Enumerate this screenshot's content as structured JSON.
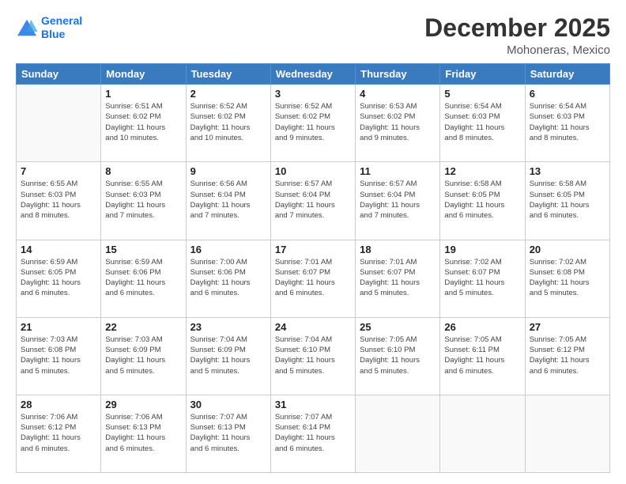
{
  "header": {
    "logo_line1": "General",
    "logo_line2": "Blue",
    "title": "December 2025",
    "subtitle": "Mohoneras, Mexico"
  },
  "weekdays": [
    "Sunday",
    "Monday",
    "Tuesday",
    "Wednesday",
    "Thursday",
    "Friday",
    "Saturday"
  ],
  "weeks": [
    [
      {
        "day": "",
        "info": ""
      },
      {
        "day": "1",
        "info": "Sunrise: 6:51 AM\nSunset: 6:02 PM\nDaylight: 11 hours\nand 10 minutes."
      },
      {
        "day": "2",
        "info": "Sunrise: 6:52 AM\nSunset: 6:02 PM\nDaylight: 11 hours\nand 10 minutes."
      },
      {
        "day": "3",
        "info": "Sunrise: 6:52 AM\nSunset: 6:02 PM\nDaylight: 11 hours\nand 9 minutes."
      },
      {
        "day": "4",
        "info": "Sunrise: 6:53 AM\nSunset: 6:02 PM\nDaylight: 11 hours\nand 9 minutes."
      },
      {
        "day": "5",
        "info": "Sunrise: 6:54 AM\nSunset: 6:03 PM\nDaylight: 11 hours\nand 8 minutes."
      },
      {
        "day": "6",
        "info": "Sunrise: 6:54 AM\nSunset: 6:03 PM\nDaylight: 11 hours\nand 8 minutes."
      }
    ],
    [
      {
        "day": "7",
        "info": "Sunrise: 6:55 AM\nSunset: 6:03 PM\nDaylight: 11 hours\nand 8 minutes."
      },
      {
        "day": "8",
        "info": "Sunrise: 6:55 AM\nSunset: 6:03 PM\nDaylight: 11 hours\nand 7 minutes."
      },
      {
        "day": "9",
        "info": "Sunrise: 6:56 AM\nSunset: 6:04 PM\nDaylight: 11 hours\nand 7 minutes."
      },
      {
        "day": "10",
        "info": "Sunrise: 6:57 AM\nSunset: 6:04 PM\nDaylight: 11 hours\nand 7 minutes."
      },
      {
        "day": "11",
        "info": "Sunrise: 6:57 AM\nSunset: 6:04 PM\nDaylight: 11 hours\nand 7 minutes."
      },
      {
        "day": "12",
        "info": "Sunrise: 6:58 AM\nSunset: 6:05 PM\nDaylight: 11 hours\nand 6 minutes."
      },
      {
        "day": "13",
        "info": "Sunrise: 6:58 AM\nSunset: 6:05 PM\nDaylight: 11 hours\nand 6 minutes."
      }
    ],
    [
      {
        "day": "14",
        "info": "Sunrise: 6:59 AM\nSunset: 6:05 PM\nDaylight: 11 hours\nand 6 minutes."
      },
      {
        "day": "15",
        "info": "Sunrise: 6:59 AM\nSunset: 6:06 PM\nDaylight: 11 hours\nand 6 minutes."
      },
      {
        "day": "16",
        "info": "Sunrise: 7:00 AM\nSunset: 6:06 PM\nDaylight: 11 hours\nand 6 minutes."
      },
      {
        "day": "17",
        "info": "Sunrise: 7:01 AM\nSunset: 6:07 PM\nDaylight: 11 hours\nand 6 minutes."
      },
      {
        "day": "18",
        "info": "Sunrise: 7:01 AM\nSunset: 6:07 PM\nDaylight: 11 hours\nand 5 minutes."
      },
      {
        "day": "19",
        "info": "Sunrise: 7:02 AM\nSunset: 6:07 PM\nDaylight: 11 hours\nand 5 minutes."
      },
      {
        "day": "20",
        "info": "Sunrise: 7:02 AM\nSunset: 6:08 PM\nDaylight: 11 hours\nand 5 minutes."
      }
    ],
    [
      {
        "day": "21",
        "info": "Sunrise: 7:03 AM\nSunset: 6:08 PM\nDaylight: 11 hours\nand 5 minutes."
      },
      {
        "day": "22",
        "info": "Sunrise: 7:03 AM\nSunset: 6:09 PM\nDaylight: 11 hours\nand 5 minutes."
      },
      {
        "day": "23",
        "info": "Sunrise: 7:04 AM\nSunset: 6:09 PM\nDaylight: 11 hours\nand 5 minutes."
      },
      {
        "day": "24",
        "info": "Sunrise: 7:04 AM\nSunset: 6:10 PM\nDaylight: 11 hours\nand 5 minutes."
      },
      {
        "day": "25",
        "info": "Sunrise: 7:05 AM\nSunset: 6:10 PM\nDaylight: 11 hours\nand 5 minutes."
      },
      {
        "day": "26",
        "info": "Sunrise: 7:05 AM\nSunset: 6:11 PM\nDaylight: 11 hours\nand 6 minutes."
      },
      {
        "day": "27",
        "info": "Sunrise: 7:05 AM\nSunset: 6:12 PM\nDaylight: 11 hours\nand 6 minutes."
      }
    ],
    [
      {
        "day": "28",
        "info": "Sunrise: 7:06 AM\nSunset: 6:12 PM\nDaylight: 11 hours\nand 6 minutes."
      },
      {
        "day": "29",
        "info": "Sunrise: 7:06 AM\nSunset: 6:13 PM\nDaylight: 11 hours\nand 6 minutes."
      },
      {
        "day": "30",
        "info": "Sunrise: 7:07 AM\nSunset: 6:13 PM\nDaylight: 11 hours\nand 6 minutes."
      },
      {
        "day": "31",
        "info": "Sunrise: 7:07 AM\nSunset: 6:14 PM\nDaylight: 11 hours\nand 6 minutes."
      },
      {
        "day": "",
        "info": ""
      },
      {
        "day": "",
        "info": ""
      },
      {
        "day": "",
        "info": ""
      }
    ]
  ]
}
